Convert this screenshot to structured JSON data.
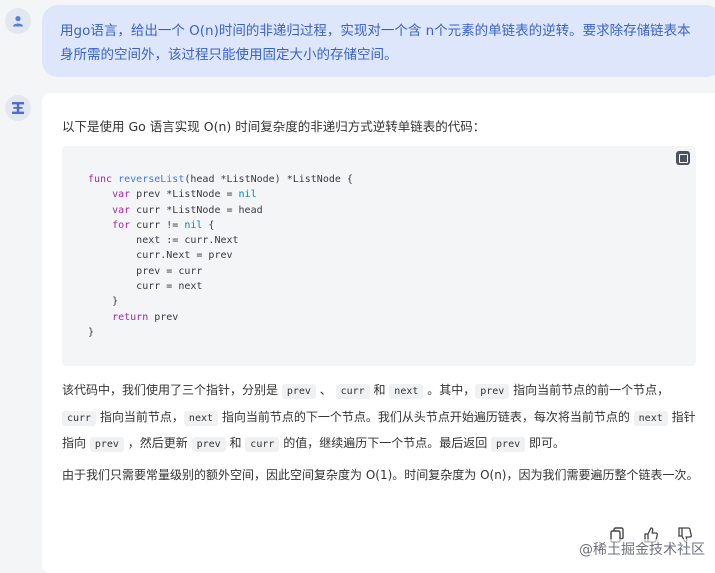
{
  "user_message": "用go语言，给出一个 O(n)时间的非递归过程，实现对一个含 n个元素的单链表的逆转。要求除存储链表本身所需的空间外，该过程只能使用固定大小的存储空间。",
  "answer": {
    "intro": "以下是使用 Go 语言实现 O(n) 时间复杂度的非递归方式逆转单链表的代码：",
    "code": {
      "line1_func": "func",
      "line1_name": "reverseList",
      "line1_sig": "(head *ListNode) *ListNode {",
      "line2_kw": "var",
      "line2_rest": " prev *ListNode = ",
      "line2_nil": "nil",
      "line3_kw": "var",
      "line3_rest": " curr *ListNode = head",
      "line4_kw": "for",
      "line4_mid": " curr != ",
      "line4_nil": "nil",
      "line4_end": " {",
      "line5": "next := curr.Next",
      "line6": "curr.Next = prev",
      "line7": "prev = curr",
      "line8": "curr = next",
      "line9": "}",
      "line10_kw": "return",
      "line10_rest": " prev",
      "line11": "}"
    },
    "para1": {
      "t1": "该代码中，我们使用了三个指针，分别是 ",
      "c_prev": "prev",
      "t2": " 、 ",
      "c_curr": "curr",
      "t3": " 和 ",
      "c_next": "next",
      "t4": " 。其中，",
      "t5": " 指向当前节点的前一个节点，",
      "t6": " 指向当前节点，",
      "t7": " 指向当前节点的下一个节点。我们从头节点开始遍历链表，每次将当前节点的 ",
      "t8": " 指针指向 ",
      "t9": " ，然后更新 ",
      "t10": " 和 ",
      "t11": " 的值，继续遍历下一个节点。最后返回 ",
      "t12": " 即可。"
    },
    "para2": "由于我们只需要常量级别的额外空间，因此空间复杂度为 O(1)。时间复杂度为 O(n)，因为我们需要遍历整个链表一次。"
  },
  "watermark": "@稀土掘金技术社区"
}
